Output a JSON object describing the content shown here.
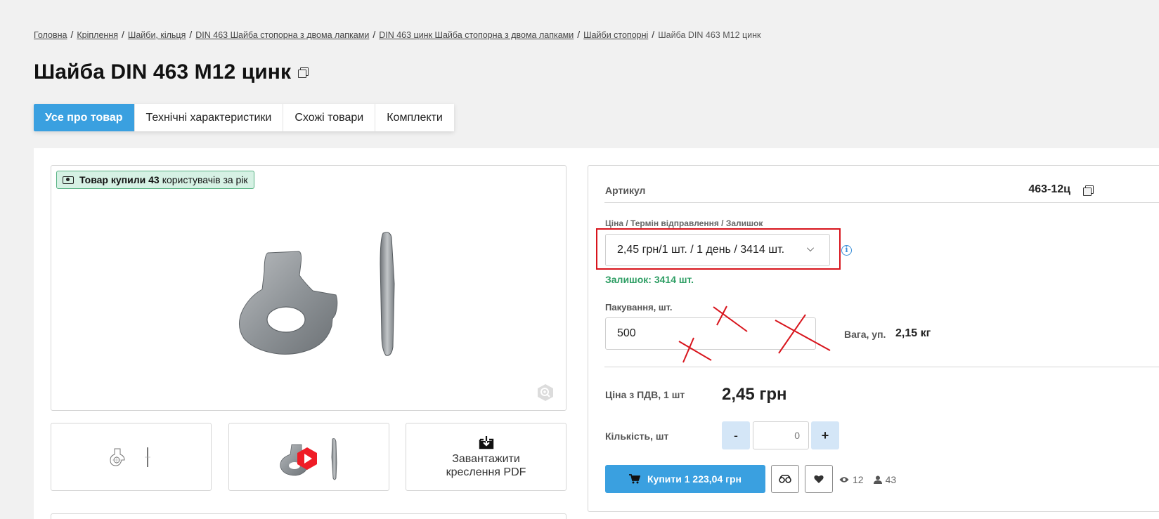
{
  "breadcrumb": {
    "items": [
      "Головна",
      "Кріплення",
      "Шайби, кільця",
      "DIN 463 Шайба стопорна з двома лапками",
      "DIN 463 цинк Шайба стопорна з двома лапками",
      "Шайби стопорні"
    ],
    "current": "Шайба DIN 463 M12 цинк"
  },
  "product": {
    "title": "Шайба DIN 463 M12 цинк"
  },
  "tabs": [
    "Усе про товар",
    "Технічні характеристики",
    "Схожі товари",
    "Комплекти"
  ],
  "gallery": {
    "badge_bold": "Товар купили 43",
    "badge_text": "користувачів за рік",
    "pdf_label_1": "Завантажити",
    "pdf_label_2": "креслення PDF"
  },
  "info": {
    "sku_label": "Артикул",
    "sku_value": "463-12ц",
    "price_label": "Ціна / Термін відправлення / Залишок",
    "price_option": "2,45 грн/1 шт. / 1 день / 3414 шт.",
    "stock_text": "Залишок: 3414 шт.",
    "pack_label": "Пакування, шт.",
    "pack_value": "500",
    "weight_label": "Вага, уп.",
    "weight_value": "2,15 кг",
    "vat_label": "Ціна з ПДВ, 1 шт",
    "vat_price": "2,45 грн",
    "qty_label": "Кількість, шт",
    "qty_minus": "-",
    "qty_plus": "+",
    "qty_value": "0",
    "buy_label": "Купити 1 223,04 грн",
    "views": "12",
    "buyers": "43"
  },
  "colors": {
    "accent": "#3aa0e0",
    "highlight": "#d8141c",
    "stock": "#2e9e64",
    "badge_bg": "#d6f1e4"
  },
  "icons": [
    "copy-icon",
    "money-icon",
    "zoom-icon",
    "play-icon",
    "download-icon",
    "chevron-down-icon",
    "info-icon",
    "cart-icon",
    "compare-icon",
    "heart-icon",
    "eye-icon",
    "user-icon"
  ]
}
